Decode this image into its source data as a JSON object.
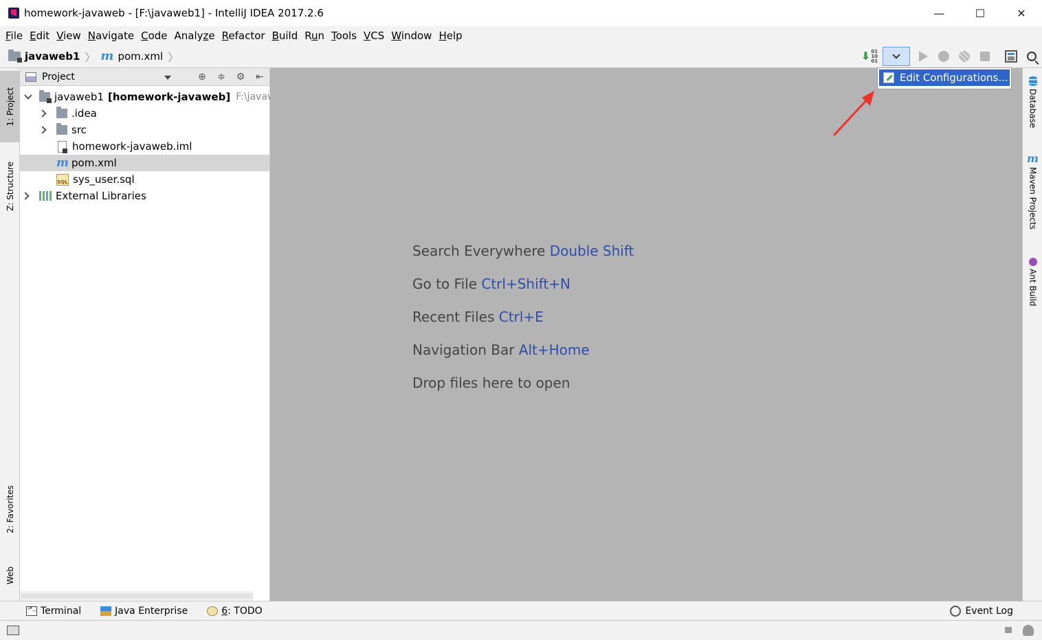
{
  "window": {
    "title": "homework-javaweb - [F:\\javaweb1] - IntelliJ IDEA 2017.2.6",
    "controls": [
      "—",
      "☐",
      "✕"
    ]
  },
  "menu": [
    {
      "label": "File",
      "u": "F",
      "rest": "ile"
    },
    {
      "label": "Edit",
      "u": "E",
      "rest": "dit"
    },
    {
      "label": "View",
      "u": "V",
      "rest": "iew"
    },
    {
      "label": "Navigate",
      "u": "N",
      "rest": "avigate"
    },
    {
      "label": "Code",
      "u": "C",
      "rest": "ode"
    },
    {
      "label": "Analyze",
      "pre": "Analy",
      "u": "z",
      "rest": "e"
    },
    {
      "label": "Refactor",
      "u": "R",
      "rest": "efactor"
    },
    {
      "label": "Build",
      "u": "B",
      "rest": "uild"
    },
    {
      "label": "Run",
      "pre": "R",
      "u": "u",
      "rest": "n"
    },
    {
      "label": "Tools",
      "u": "T",
      "rest": "ools"
    },
    {
      "label": "VCS",
      "pre": "",
      "u": "V",
      "rest": "CS"
    },
    {
      "label": "Window",
      "u": "W",
      "rest": "indow"
    },
    {
      "label": "Help",
      "u": "H",
      "rest": "elp"
    }
  ],
  "breadcrumb": {
    "project": "javaweb1",
    "file": "pom.xml",
    "separator": "〉"
  },
  "run_dropdown": {
    "item": "Edit Configurations..."
  },
  "left_tabs": {
    "project": "1: Project",
    "structure": "Z: Structure",
    "favorites": "2: Favorites",
    "web": "Web"
  },
  "project_panel": {
    "title": "Project",
    "tools": [
      "⊕",
      "≑",
      "⚙",
      "⇤"
    ]
  },
  "tree": {
    "root": {
      "name": "javaweb1",
      "module": "[homework-javaweb]",
      "path": "F:\\javawe"
    },
    "idea": ".idea",
    "src": "src",
    "iml": "homework-javaweb.iml",
    "pom": "pom.xml",
    "sql": "sys_user.sql",
    "sql_badge": "SQL",
    "libs": "External Libraries"
  },
  "editor_hints": [
    {
      "text": "Search Everywhere",
      "key": "Double Shift"
    },
    {
      "text": "Go to File",
      "key": "Ctrl+Shift+N"
    },
    {
      "text": "Recent Files",
      "key": "Ctrl+E"
    },
    {
      "text": "Navigation Bar",
      "key": "Alt+Home"
    },
    {
      "text": "Drop files here to open",
      "key": ""
    }
  ],
  "right_tabs": {
    "database": "Database",
    "maven": "Maven Projects",
    "ant": "Ant Build",
    "maven_icon": "m"
  },
  "bottom_tools": {
    "terminal": "Terminal",
    "java_enterprise": "Java Enterprise",
    "todo_num": "6",
    "todo_label": ": TODO",
    "event_log": "Event Log"
  },
  "icons": {
    "maven": "m"
  }
}
